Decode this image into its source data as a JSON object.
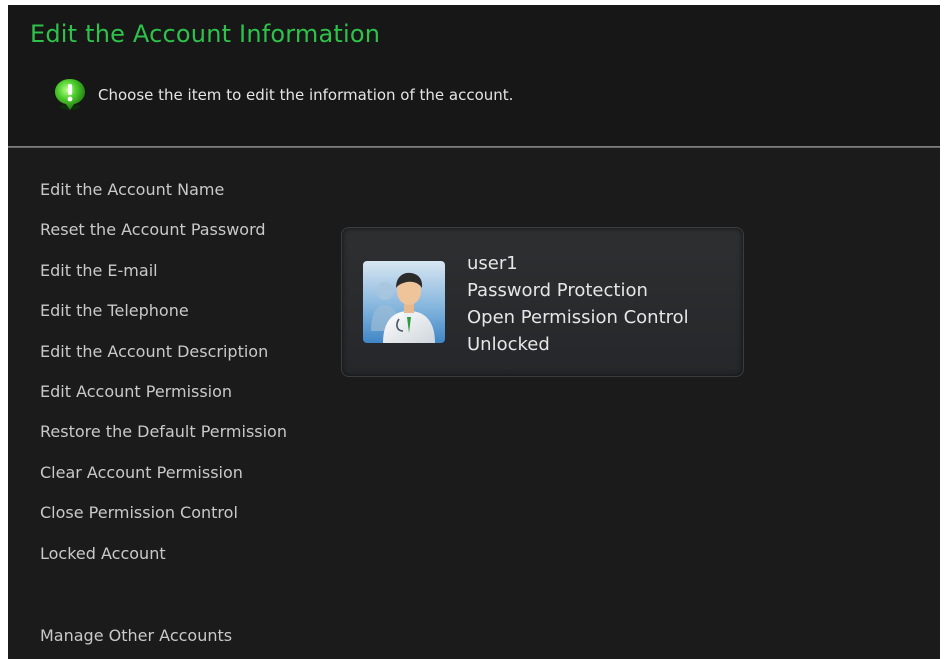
{
  "header": {
    "title": "Edit the Account Information",
    "hint": "Choose the item to edit the information of the account."
  },
  "menu": {
    "items": [
      {
        "label": "Edit the Account Name"
      },
      {
        "label": "Reset the Account Password"
      },
      {
        "label": "Edit the E-mail"
      },
      {
        "label": "Edit the Telephone"
      },
      {
        "label": "Edit the Account Description"
      },
      {
        "label": "Edit Account Permission"
      },
      {
        "label": "Restore the Default Permission"
      },
      {
        "label": "Clear Account Permission"
      },
      {
        "label": "Close Permission Control"
      },
      {
        "label": "Locked Account"
      }
    ],
    "manage_label": "Manage Other Accounts"
  },
  "account": {
    "username": "user1",
    "protection": "Password Protection",
    "permission": "Open Permission Control",
    "lock_status": "Unlocked"
  },
  "icons": {
    "hint": "info-icon",
    "avatar": "user-avatar-icon"
  },
  "colors": {
    "accent": "#2ec24a",
    "background": "#1b1b1b"
  }
}
